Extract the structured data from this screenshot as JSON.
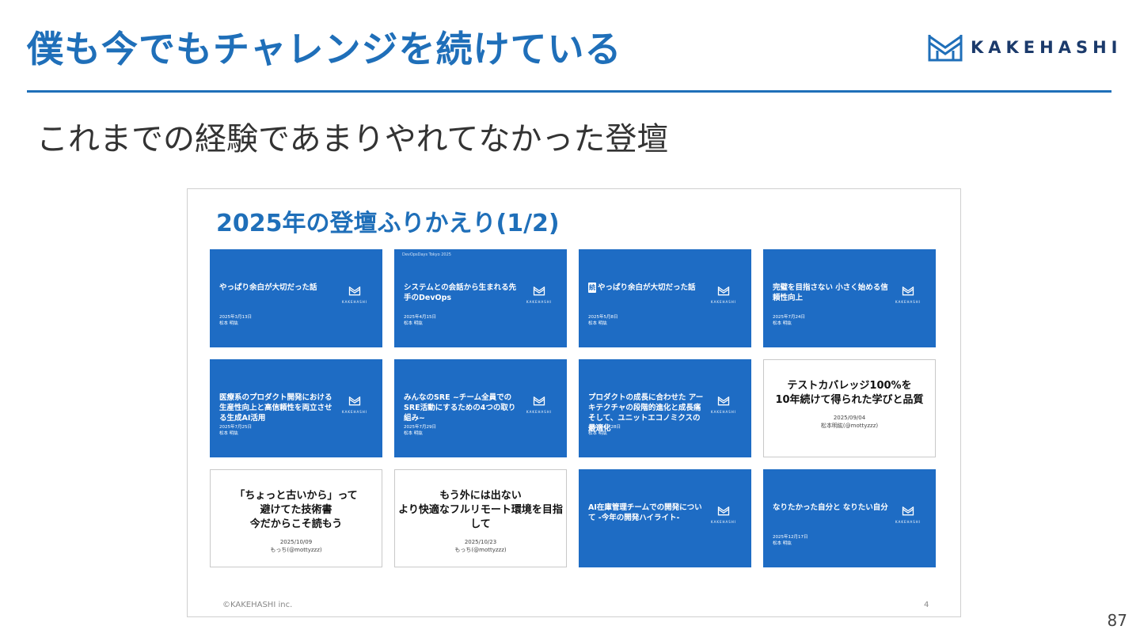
{
  "header": {
    "title": "僕も今でもチャレンジを続けている",
    "logo_text": "KAKEHASHI"
  },
  "subtitle": "これまでの経験であまりやれてなかった登壇",
  "page_number": "87",
  "colors": {
    "accent": "#1f6fb9",
    "card_blue": "#1e6cc4"
  },
  "slide": {
    "title": "2025年の登壇ふりかえり(1/2)",
    "footer": "©KAKEHASHI inc.",
    "number": "4",
    "cards": [
      {
        "type": "blue",
        "event": "",
        "title": "やっぱり余白が大切だった話",
        "date": "2025年3月13日",
        "author": "松本 明紘",
        "logo": "KAKEHASHI"
      },
      {
        "type": "blue",
        "event": "DevOpsDays Tokyo 2025",
        "title": "システムとの会話から生まれる先手のDevOps",
        "date": "2025年4月15日",
        "author": "松本 明紘",
        "logo": "KAKEHASHI"
      },
      {
        "type": "blue",
        "event": "",
        "badge": "続",
        "title": "やっぱり余白が大切だった話",
        "date": "2025年5月8日",
        "author": "松本 明紘",
        "logo": "KAKEHASHI"
      },
      {
        "type": "blue",
        "event": "",
        "title": "完璧を目指さない 小さく始める信頼性向上",
        "date": "2025年7月24日",
        "author": "松本 明紘",
        "logo": "KAKEHASHI"
      },
      {
        "type": "blue",
        "event": "",
        "title": "医療系のプロダクト開発における 生産性向上と高信頼性を両立させる生成AI活用",
        "date": "2025年7月25日",
        "author": "松本 明紘",
        "logo": "KAKEHASHI"
      },
      {
        "type": "blue",
        "event": "",
        "title": "みんなのSRE ~チーム全員でのSRE活動にするための4つの取り組み~",
        "date": "2025年7月29日",
        "author": "松本 明紘",
        "logo": "KAKEHASHI"
      },
      {
        "type": "blue",
        "event": "",
        "title": "プロダクトの成長に合わせた アーキテクチャの段階的進化と成長痛 そして、ユニットエコノミクスの最適化",
        "date": "2025年8月28日",
        "author": "松本 明紘",
        "logo": "KAKEHASHI"
      },
      {
        "type": "white",
        "event": "",
        "title": "テストカバレッジ100%を\n10年続けて得られた学びと品質",
        "date": "2025/09/04\n松本明紘(@mottyzzz)"
      },
      {
        "type": "white",
        "event": "",
        "title": "「ちょっと古いから」って\n避けてた技術書\n今だからこそ読もう",
        "date": "2025/10/09\nもっち(@mottyzzz)"
      },
      {
        "type": "white",
        "event": "",
        "title": "もう外には出ない\nより快適なフルリモート環境を目指して",
        "date": "2025/10/23\nもっち(@mottyzzz)"
      },
      {
        "type": "blue",
        "event": "",
        "title": "AI在庫管理チームでの開発について -今年の開発ハイライト-",
        "date": "",
        "author": "",
        "logo": "KAKEHASHI"
      },
      {
        "type": "blue",
        "event": "",
        "title": "なりたかった自分と なりたい自分",
        "date": "2025年12月17日",
        "author": "松本 明紘",
        "logo": "KAKEHASHI"
      }
    ]
  }
}
